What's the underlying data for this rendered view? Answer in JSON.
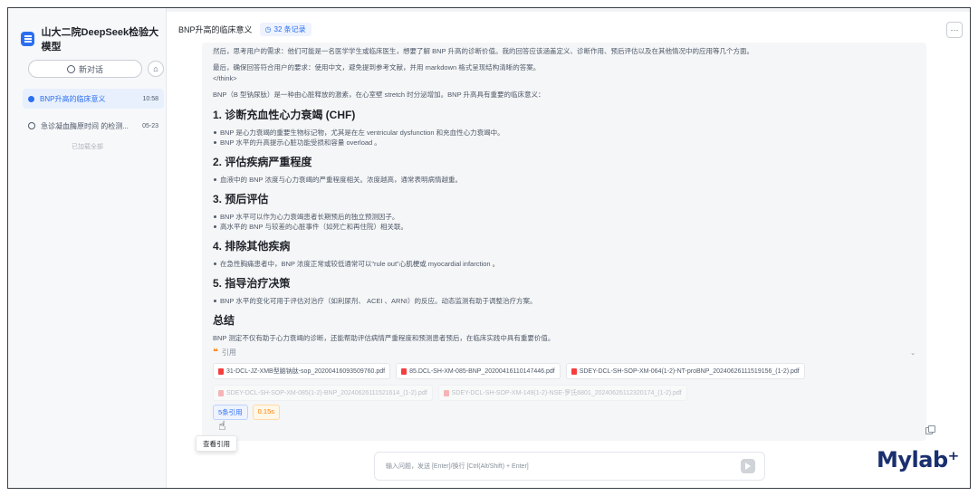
{
  "sidebar": {
    "brand": "山大二院DeepSeek检验大模型",
    "new_chat_label": "新对话",
    "home_icon": "home-icon",
    "conversations": [
      {
        "title": "BNP升高的临床意义",
        "time": "10:58",
        "active": true
      },
      {
        "title": "急诊凝血酶原时间 的检测...",
        "time": "05-23",
        "active": false
      }
    ],
    "loaded_all": "已加载全部"
  },
  "header": {
    "title": "BNP升高的临床意义",
    "records": "32 条记录",
    "more_label": "···"
  },
  "content": {
    "line1": "然后，思考用户的需求：他们可能是一名医学学生或临床医生，想要了解 BNP 升高的诊断价值。我的回答应该涵盖定义、诊断作用、预后评估以及在其他情况中的应用等几个方面。",
    "line2": "最后，确保回答符合用户的要求：使用中文，避免提到参考文献，并用 markdown 格式呈现结构清晰的答案。",
    "think_end": "</think>",
    "intro": "BNP（B 型钠尿肽）是一种由心脏释放的激素，在心室壁 stretch 时分泌增加。BNP 升高具有重要的临床意义：",
    "sections": [
      {
        "heading": "1. 诊断充血性心力衰竭 (CHF)",
        "bullets": [
          "BNP 是心力衰竭的重要生物标记物，尤其是在左 ventricular dysfunction 和充血性心力衰竭中。",
          "BNP 水平的升高提示心脏功能受损和容量 overload 。"
        ]
      },
      {
        "heading": "2. 评估疾病严重程度",
        "bullets": [
          "血液中的 BNP 浓度与心力衰竭的严重程度相关。浓度越高，通常表明病情越重。"
        ]
      },
      {
        "heading": "3. 预后评估",
        "bullets": [
          "BNP 水平可以作为心力衰竭患者长期预后的独立预测因子。",
          "高水平的 BNP 与较差的心脏事件（如死亡和再住院）相关联。"
        ]
      },
      {
        "heading": "4. 排除其他疾病",
        "bullets": [
          "在急性胸痛患者中，BNP 浓度正常或较低通常可以\"rule out\"心肌梗或 myocardial infarction 。"
        ]
      },
      {
        "heading": "5. 指导治疗决策",
        "bullets": [
          "BNP 水平的变化可用于评估对治疗（如利尿剂、 ACEI 、ARNI）的反应。动态监测有助于调整治疗方案。"
        ]
      }
    ],
    "summary_heading": "总结",
    "summary_text": "BNP 测定不仅有助于心力衰竭的诊断，还能帮助评估病情严重程度和预测患者预后，在临床实践中具有重要价值。"
  },
  "citations": {
    "label": "引用",
    "files": [
      "31-DCL-JZ-XMB型脑钠肽-sop_20200416093509760.pdf",
      "85.DCL-SH-XM-085-BNP_20200416110147446.pdf",
      "SDEY-DCL-SH-SOP-XM-064(1-2)-NT-proBNP_20240626111519156_(1-2).pdf"
    ],
    "faded_files": [
      "SDEY-DCL-SH-SOP-XM-085(1-2)-BNP_20240626111521614_(1-2).pdf",
      "SDEY-DCL-SH-SOP-XM-149(1-2)-NSE-罗氏6801_20240626112320174_(1-2).pdf"
    ],
    "count_chip": "5条引用",
    "time_chip": "0.15s"
  },
  "tooltip": "查看引用",
  "input": {
    "placeholder": "输入问题，发送 [Enter]/换行 [Ctrl(Alt/Shift) + Enter]"
  },
  "logo": "Mylab⁺",
  "colors": {
    "accent": "#2b6ff0",
    "logo": "#1a2f6e"
  }
}
